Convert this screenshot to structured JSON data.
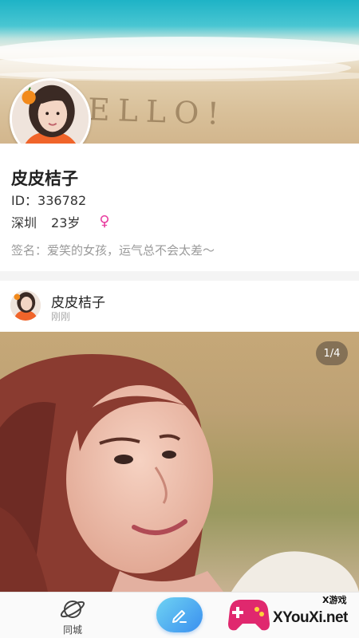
{
  "cover": {
    "sand_text": "ELLO!"
  },
  "profile": {
    "nickname": "皮皮桔子",
    "id_text": "ID：336782",
    "city": "深圳",
    "age": "23岁",
    "gender_symbol": "♀",
    "signature": "签名：爱笑的女孩，运气总不会太差～"
  },
  "post": {
    "author": "皮皮桔子",
    "time": "刚刚",
    "photo_counter": "1/4"
  },
  "tabbar": {
    "city_label": "同城",
    "publish_icon": "pencil-icon"
  },
  "watermark": {
    "text": "XYouXi.net",
    "sub": "X游戏"
  },
  "colors": {
    "gender": "#e83a9e",
    "publish_start": "#6fd3f2",
    "publish_end": "#3a8ff0"
  }
}
